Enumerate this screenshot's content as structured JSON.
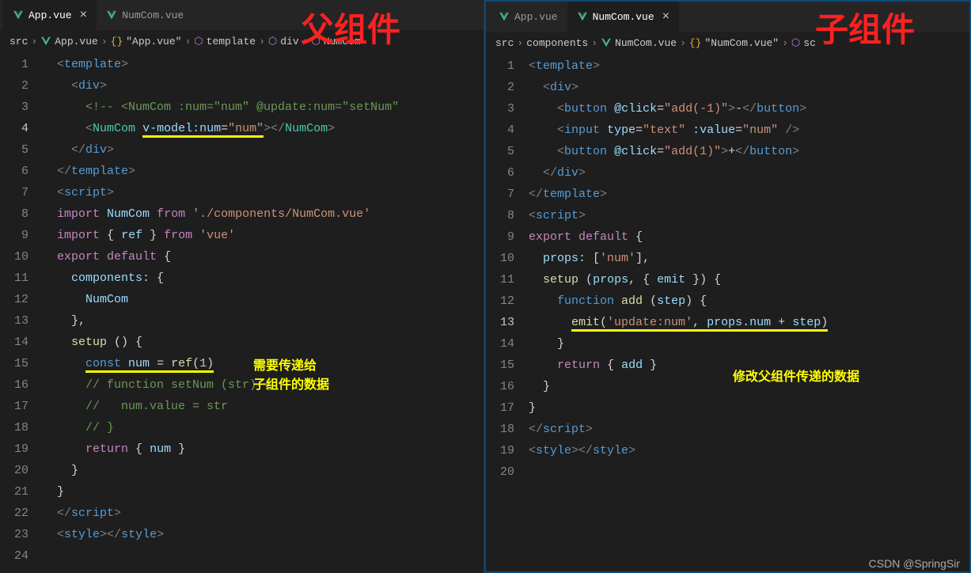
{
  "labels": {
    "parent": "父组件",
    "child": "子组件"
  },
  "left": {
    "tabs": [
      {
        "name": "App.vue",
        "active": true
      },
      {
        "name": "NumCom.vue",
        "active": false
      }
    ],
    "breadcrumb": [
      "src",
      "App.vue",
      "\"App.vue\"",
      "template",
      "div",
      "NumCom"
    ],
    "annotation": "需要传递给\n子组件的数据",
    "code": {
      "l1": {
        "tpl": "template"
      },
      "l2": {
        "div": "div"
      },
      "l3_comment": "<!-- <NumCom :num=\"num\" @update:num=\"setNum\"",
      "l4": {
        "tag": "NumCom",
        "attr": "v-model:num",
        "val": "\"num\""
      },
      "l5": {
        "div": "div"
      },
      "l6": {
        "tpl": "template"
      },
      "l7": {
        "script": "script"
      },
      "l8": {
        "imp": "import",
        "name": "NumCom",
        "from": "from",
        "path": "'./components/NumCom.vue'"
      },
      "l9": {
        "imp": "import",
        "ref": "ref",
        "from": "from",
        "vue": "'vue'"
      },
      "l10": {
        "exp": "export",
        "def": "default"
      },
      "l11": {
        "components": "components"
      },
      "l12": {
        "name": "NumCom"
      },
      "l14": {
        "setup": "setup"
      },
      "l15": {
        "const": "const",
        "num": "num",
        "ref": "ref",
        "one": "1"
      },
      "l16_comment": "// function setNum (str) {",
      "l17_comment": "//   num.value = str",
      "l18_comment": "// }",
      "l19": {
        "ret": "return",
        "num": "num"
      },
      "l22": {
        "script": "script"
      },
      "l23": {
        "style": "style"
      }
    }
  },
  "right": {
    "tabs": [
      {
        "name": "App.vue",
        "active": false
      },
      {
        "name": "NumCom.vue",
        "active": true
      }
    ],
    "breadcrumb": [
      "src",
      "components",
      "NumCom.vue",
      "\"NumCom.vue\"",
      "sc"
    ],
    "annotation": "修改父组件传递的数据",
    "code": {
      "l1": {
        "tpl": "template"
      },
      "l2": {
        "div": "div"
      },
      "l3": {
        "btn": "button",
        "click": "@click",
        "val": "\"add(-1)\"",
        "txt": "-"
      },
      "l4": {
        "inp": "input",
        "type": "type",
        "tval": "\"text\"",
        "vbind": ":value",
        "vval": "\"num\""
      },
      "l5": {
        "btn": "button",
        "click": "@click",
        "val": "\"add(1)\"",
        "txt": "+"
      },
      "l6": {
        "div": "div"
      },
      "l7": {
        "tpl": "template"
      },
      "l8": {
        "script": "script"
      },
      "l9": {
        "exp": "export",
        "def": "default"
      },
      "l10": {
        "props": "props",
        "num": "'num'"
      },
      "l11": {
        "setup": "setup",
        "props2": "props",
        "emit": "emit"
      },
      "l12": {
        "fn": "function",
        "add": "add",
        "step": "step"
      },
      "l13": {
        "emit": "emit",
        "evt": "'update:num'",
        "props": "props",
        "num": "num",
        "step": "step"
      },
      "l15": {
        "ret": "return",
        "add": "add"
      },
      "l18": {
        "script": "script"
      },
      "l19": {
        "style": "style"
      }
    }
  },
  "watermark": "CSDN @SpringSir"
}
